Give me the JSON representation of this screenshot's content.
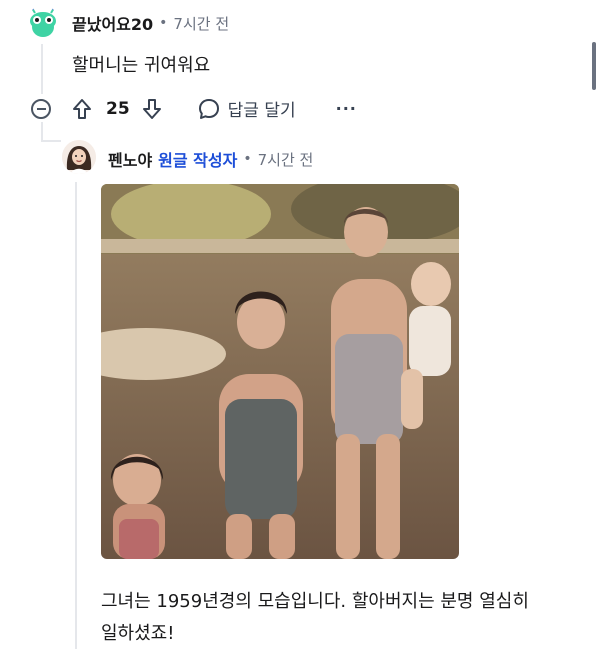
{
  "comment1": {
    "username": "끝났어요20",
    "separator": "•",
    "time": "7시간 전",
    "body": "할머니는 귀여워요",
    "votes": "25",
    "reply_label": "답글 달기",
    "more_label": "···"
  },
  "comment2": {
    "username": "펜노야",
    "op_badge": "원글 작성자",
    "separator": "•",
    "time": "7시간 전",
    "body_line1": "그녀는 1959년경의 모습입니다. 할아버지는 분명 열심히",
    "body_line2": "일하셨죠!"
  },
  "colors": {
    "op_badge": "#1d4ed8",
    "thread_line": "#e5e7eb",
    "avatar1_bg": "#3fd3a4"
  },
  "icons": [
    "alien-avatar-icon",
    "user-avatar-icon",
    "collapse-icon",
    "upvote-icon",
    "downvote-icon",
    "reply-bubble-icon"
  ]
}
